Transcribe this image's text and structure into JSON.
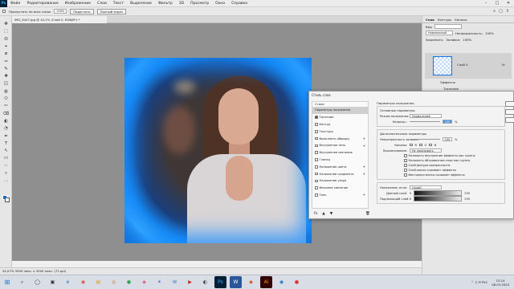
{
  "menubar": {
    "logo": "Ps",
    "items": [
      "Файл",
      "Редактирование",
      "Изображение",
      "Слои",
      "Текст",
      "Выделение",
      "Фильтр",
      "3D",
      "Просмотр",
      "Окно",
      "Справка"
    ],
    "controls": [
      "–",
      "□",
      "✕"
    ]
  },
  "optionsbar": {
    "auto_select": "Пропустить на всех слоях",
    "zoom_value": "100%",
    "fit_screen": "Подогнать",
    "fill_screen": "Полный экран",
    "right_icons": [
      "⌕",
      "▢",
      "⇪"
    ]
  },
  "document": {
    "tab_title": "IMG_9447.jpg @ 44,1% (Слой 0, RGB/8*) *"
  },
  "toolbar": {
    "tools": [
      "✥",
      "⬚",
      "ʘ",
      "⌖",
      "⧄",
      "✑",
      "✎",
      "✚",
      "◫",
      "◍",
      "⬭",
      "✏",
      "⌫",
      "◐",
      "◔",
      "✒",
      "T",
      "↖",
      "▭",
      "☞",
      "⌕",
      "…"
    ],
    "active_index": 22,
    "fg_color": "#0d6bd6",
    "bg_color": "#ffffff"
  },
  "status": {
    "text": "44,07%   3000 пикс. x 3000 пикс. (72 ppi)"
  },
  "right_panel": {
    "tabs": [
      "Слои",
      "Контуры",
      "Каналы"
    ],
    "active_tab": 0,
    "filter_label": "Вид",
    "mode_value": "Нормальный",
    "opacity_label": "Непрозрачность:",
    "opacity_value": "100%",
    "lock_label": "Закрепить:",
    "fill_label": "Заливка:",
    "fill_value": "100%",
    "layer_name": "Слой 0",
    "fx": "fx",
    "effects_label": "Эффекты",
    "effect_item": "Тиснение"
  },
  "dialog": {
    "title": "Стиль слоя",
    "styles_header": "Стили",
    "styles": [
      {
        "label": "Параметры наложения",
        "checkbox": false,
        "checked": false,
        "plus": false,
        "selected": true
      },
      {
        "label": "Тиснение",
        "checkbox": true,
        "checked": true,
        "plus": false,
        "selected": false
      },
      {
        "label": "Контур",
        "checkbox": true,
        "checked": false,
        "plus": false,
        "selected": false
      },
      {
        "label": "Текстура",
        "checkbox": true,
        "checked": false,
        "plus": false,
        "selected": false
      },
      {
        "label": "Выполнить обводку",
        "checkbox": true,
        "checked": false,
        "plus": true,
        "selected": false
      },
      {
        "label": "Внутренняя тень",
        "checkbox": true,
        "checked": false,
        "plus": true,
        "selected": false
      },
      {
        "label": "Внутреннее свечение",
        "checkbox": true,
        "checked": false,
        "plus": false,
        "selected": false
      },
      {
        "label": "Глянец",
        "checkbox": true,
        "checked": false,
        "plus": false,
        "selected": false
      },
      {
        "label": "Наложение цвета",
        "checkbox": true,
        "checked": false,
        "plus": true,
        "selected": false
      },
      {
        "label": "Наложение градиента",
        "checkbox": true,
        "checked": false,
        "plus": true,
        "selected": false
      },
      {
        "label": "Наложение узора",
        "checkbox": true,
        "checked": false,
        "plus": false,
        "selected": false
      },
      {
        "label": "Внешнее свечение",
        "checkbox": true,
        "checked": false,
        "plus": false,
        "selected": false
      },
      {
        "label": "Тень",
        "checkbox": true,
        "checked": false,
        "plus": true,
        "selected": false
      }
    ],
    "footer_icons": [
      "fx",
      "▲",
      "▼"
    ],
    "trash": "🗑",
    "params_title": "Параметры наложения",
    "general_title": "Основные параметры",
    "blend_label": "Режим наложения:",
    "blend_value": "Нормальный",
    "opacity_label": "Непрозр.:",
    "opacity_value": "100",
    "pct": "%",
    "advanced_title": "Дополнительные параметры",
    "fill_opacity_label": "Непрозрачность заливки:",
    "fill_opacity_value": "100",
    "channels_label": "Каналы:",
    "channels": [
      "R",
      "G",
      "B"
    ],
    "knockout_label": "Просвечивание:",
    "knockout_value": "Не показывать",
    "options": [
      "Наложить внутренние эффекты как группу",
      "Наложить обтравочные слои как группу",
      "Слой-фигура прозрачности",
      "Слой-маска скрывает эффекты",
      "Векторная маска скрывает эффекты"
    ],
    "blend_if_label": "Наложение, если:",
    "blend_if_value": "Серый",
    "this_layer_label": "Данный слой:",
    "under_layer_label": "Подлежащий слой:",
    "range_min": "0",
    "range_max": "255"
  },
  "taskbar": {
    "apps": [
      {
        "glyph": "⌕",
        "color": "#3c3c3c",
        "bg": "transparent"
      },
      {
        "glyph": "◯",
        "color": "#3c3c3c",
        "bg": "transparent"
      },
      {
        "glyph": "▣",
        "color": "#3c3c3c",
        "bg": "transparent"
      },
      {
        "glyph": "e",
        "color": "#1f70c9",
        "bg": "transparent"
      },
      {
        "glyph": "◉",
        "color": "#e14a3a",
        "bg": "transparent"
      },
      {
        "glyph": "▤",
        "color": "#d9a21b",
        "bg": "transparent"
      },
      {
        "glyph": "◎",
        "color": "#e0732a",
        "bg": "transparent"
      },
      {
        "glyph": "●",
        "color": "#2fa84f",
        "bg": "transparent"
      },
      {
        "glyph": "◈",
        "color": "#d33b7d",
        "bg": "transparent"
      },
      {
        "glyph": "✦",
        "color": "#7a5bd6",
        "bg": "transparent"
      },
      {
        "glyph": "✉",
        "color": "#1f70c9",
        "bg": "transparent"
      },
      {
        "glyph": "▶",
        "color": "#cc1f1f",
        "bg": "transparent"
      },
      {
        "glyph": "◐",
        "color": "#3c3c3c",
        "bg": "transparent"
      },
      {
        "glyph": "Ps",
        "color": "#31a8ff",
        "bg": "#001e36"
      },
      {
        "glyph": "W",
        "color": "#ffffff",
        "bg": "#2b579a"
      },
      {
        "glyph": "◆",
        "color": "#e8522a",
        "bg": "transparent"
      },
      {
        "glyph": "Ai",
        "color": "#ff9a00",
        "bg": "#330000"
      },
      {
        "glyph": "◉",
        "color": "#1f70c9",
        "bg": "transparent"
      },
      {
        "glyph": "●",
        "color": "#e12d2d",
        "bg": "transparent"
      }
    ],
    "tray_text": "^ ♫ ✉ РУС",
    "time": "13:14",
    "date": "08.03.2020"
  }
}
